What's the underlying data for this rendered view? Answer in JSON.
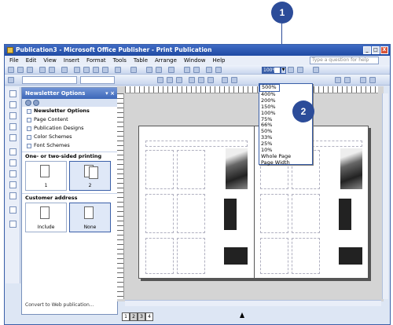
{
  "window": {
    "title": "Publication3 - Microsoft Office Publisher - Print Publication",
    "controls": [
      "_",
      "□",
      "X"
    ]
  },
  "menubar": {
    "items": [
      "File",
      "Edit",
      "View",
      "Insert",
      "Format",
      "Tools",
      "Table",
      "Arrange",
      "Window",
      "Help"
    ],
    "help_placeholder": "Type a question for help"
  },
  "toolbar": {
    "zoom_value": "100%"
  },
  "task_pane": {
    "title": "Newsletter Options",
    "items": [
      {
        "label": "Newsletter Options",
        "bold": true
      },
      {
        "label": "Page Content",
        "bold": false
      },
      {
        "label": "Publication Designs",
        "bold": false
      },
      {
        "label": "Color Schemes",
        "bold": false
      },
      {
        "label": "Font Schemes",
        "bold": false
      }
    ],
    "sided_heading": "One- or two-sided printing",
    "sided_options": [
      "1",
      "2"
    ],
    "sided_selected": "2",
    "address_heading": "Customer address",
    "address_options": [
      "Include",
      "None"
    ],
    "address_selected": "None",
    "footer_link": "Convert to Web publication..."
  },
  "zoom_dropdown": {
    "options": [
      "500%",
      "400%",
      "200%",
      "150%",
      "100%",
      "75%",
      "66%",
      "50%",
      "33%",
      "25%",
      "10%",
      "Whole Page",
      "Page Width"
    ],
    "highlighted": "500%"
  },
  "callouts": [
    "1",
    "2"
  ],
  "page_tabs": [
    "1",
    "2",
    "3",
    "4"
  ],
  "colors": {
    "accent": "#2c4c99",
    "titlebar": "#1f4aa3"
  }
}
